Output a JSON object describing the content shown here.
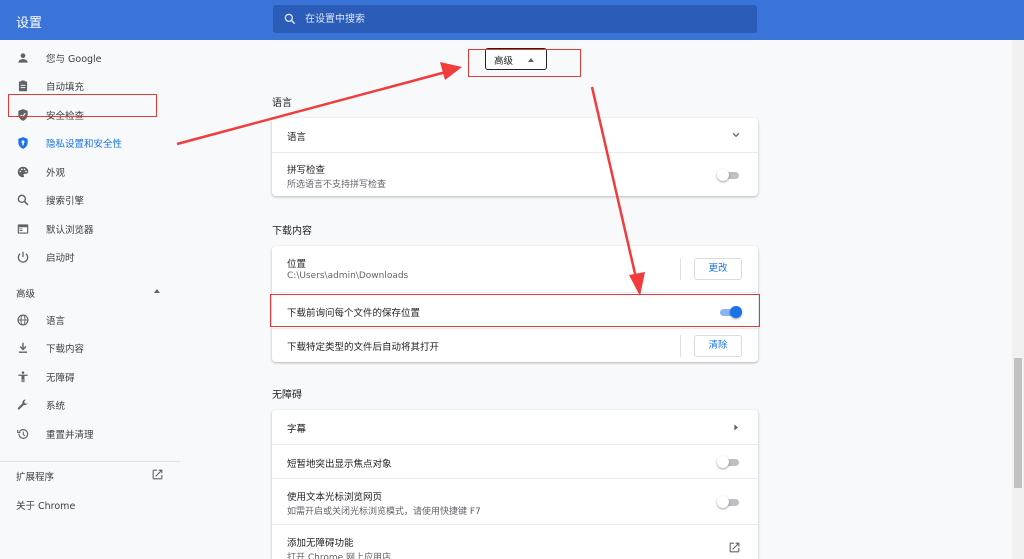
{
  "app": {
    "title": "设置"
  },
  "search": {
    "placeholder": "在设置中搜索"
  },
  "sidebar": {
    "items": [
      {
        "label": "您与 Google",
        "icon": "person-icon"
      },
      {
        "label": "自动填充",
        "icon": "clipboard-icon"
      },
      {
        "label": "安全检查",
        "icon": "shield-check-icon"
      },
      {
        "label": "隐私设置和安全性",
        "icon": "shield-icon",
        "active": true
      },
      {
        "label": "外观",
        "icon": "palette-icon"
      },
      {
        "label": "搜索引擎",
        "icon": "search-icon"
      },
      {
        "label": "默认浏览器",
        "icon": "browser-icon"
      },
      {
        "label": "启动时",
        "icon": "power-icon"
      }
    ],
    "advanced_label": "高级",
    "advanced_items": [
      {
        "label": "语言",
        "icon": "globe-icon"
      },
      {
        "label": "下载内容",
        "icon": "download-icon"
      },
      {
        "label": "无障碍",
        "icon": "accessibility-icon"
      },
      {
        "label": "系统",
        "icon": "wrench-icon"
      },
      {
        "label": "重置并清理",
        "icon": "restore-icon"
      }
    ],
    "extensions_label": "扩展程序",
    "about_label": "关于 Chrome"
  },
  "main": {
    "advanced_button_label": "高级",
    "language": {
      "title": "语言",
      "row1_label": "语言",
      "spell_title": "拼写检查",
      "spell_subtitle": "所选语言不支持拼写检查"
    },
    "downloads": {
      "title": "下载内容",
      "location_title": "位置",
      "location_path": "C:\\Users\\admin\\Downloads",
      "change_button": "更改",
      "ask_label": "下载前询问每个文件的保存位置",
      "auto_open_label": "下载特定类型的文件后自动将其打开",
      "clear_button": "清除"
    },
    "accessibility": {
      "title": "无障碍",
      "captions_label": "字幕",
      "focus_label": "短暂地突出显示焦点对象",
      "caret_title": "使用文本光标浏览网页",
      "caret_subtitle": "如需开启或关闭光标浏览模式，请使用快捷键 F7",
      "add_features_title": "添加无障碍功能",
      "add_features_subtitle": "打开 Chrome 网上应用店"
    }
  },
  "toggles": {
    "spellcheck": false,
    "ask_where_to_save": true,
    "focus_highlight": false,
    "caret_browsing": false
  },
  "colors": {
    "header": "#3b74d9",
    "accent": "#1a73e8",
    "annotation": "#e53935"
  }
}
